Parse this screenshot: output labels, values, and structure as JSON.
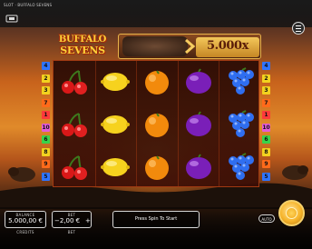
{
  "window": {
    "title": "SLOT · BUFFALO SEVENS"
  },
  "game": {
    "logo_line1": "BUFFALO",
    "logo_line2": "SEVENS",
    "max_multiplier": "5.000x"
  },
  "reels": {
    "columns": [
      [
        "cherry",
        "cherry",
        "cherry"
      ],
      [
        "lemon",
        "lemon",
        "lemon"
      ],
      [
        "orange",
        "orange",
        "orange"
      ],
      [
        "plum",
        "plum",
        "plum"
      ],
      [
        "grapes",
        "grapes",
        "grapes"
      ]
    ]
  },
  "paylines": {
    "left": [
      {
        "label": "4",
        "color": "#2f74ff"
      },
      {
        "label": "2",
        "color": "#f2d21f"
      },
      {
        "label": "3",
        "color": "#f2d21f"
      },
      {
        "label": "7",
        "color": "#ff6a1a"
      },
      {
        "label": "1",
        "color": "#ff3a3a"
      },
      {
        "label": "10",
        "color": "#e35bd9"
      },
      {
        "label": "6",
        "color": "#38d34a"
      },
      {
        "label": "8",
        "color": "#f2d21f"
      },
      {
        "label": "9",
        "color": "#ff6a1a"
      },
      {
        "label": "5",
        "color": "#2f74ff"
      }
    ],
    "right": [
      {
        "label": "4",
        "color": "#2f74ff"
      },
      {
        "label": "2",
        "color": "#f2d21f"
      },
      {
        "label": "3",
        "color": "#f2d21f"
      },
      {
        "label": "7",
        "color": "#ff6a1a"
      },
      {
        "label": "1",
        "color": "#ff3a3a"
      },
      {
        "label": "10",
        "color": "#e35bd9"
      },
      {
        "label": "6",
        "color": "#38d34a"
      },
      {
        "label": "8",
        "color": "#f2d21f"
      },
      {
        "label": "9",
        "color": "#ff6a1a"
      },
      {
        "label": "5",
        "color": "#2f74ff"
      }
    ]
  },
  "bottom": {
    "balance_label": "BALANCE",
    "balance_value": "5.000,00 €",
    "balance_sub": "CREDITS",
    "bet_label": "BET",
    "bet_value": "2,00 €",
    "bet_minus": "−",
    "bet_plus": "+",
    "bet_sub": "BET",
    "message": "Press Spin To Start",
    "auto_label": "AUTO"
  },
  "icons": {
    "menu": "hamburger-menu-icon",
    "home": "home-icon",
    "spin": "spin-button-icon"
  }
}
